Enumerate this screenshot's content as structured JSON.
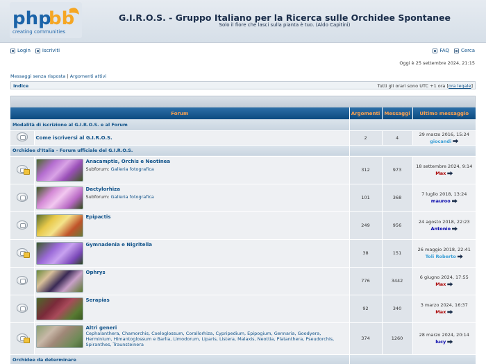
{
  "header": {
    "logo_text": "phpBB",
    "logo_tagline": "creating communities",
    "site_title": "G.I.R.O.S. - Gruppo Italiano per la Ricerca sulle Orchidee Spontanee",
    "site_description": "Solo il fiore che lasci sulla pianta è tuo. (Aldo Capitini)"
  },
  "nav": {
    "login": "Login",
    "register": "Iscriviti",
    "faq": "FAQ",
    "search": "Cerca"
  },
  "date_line": "Oggi è 25 settembre 2024, 21:15",
  "quick_links": {
    "unanswered": "Messaggi senza risposta",
    "separator": "|",
    "active": "Argomenti attivi"
  },
  "breadcrumb": {
    "index": "Indice",
    "timezone_text": "Tutti gli orari sono UTC +1 ora [",
    "legal_time": "ora legale",
    "timezone_close": "]"
  },
  "table_headers": {
    "forum": "Forum",
    "topics": "Argomenti",
    "posts": "Messaggi",
    "last_post": "Ultimo messaggio"
  },
  "categories": [
    {
      "name": "Modalità di iscrizione al G.I.R.O.S. e al Forum",
      "forums": [
        {
          "name": "Come iscriversi al G.I.R.O.S.",
          "subforum": "",
          "topics": "2",
          "posts": "4",
          "last_date": "29 marzo 2016, 15:24",
          "last_user": "giocandi",
          "user_color": "#3a9fd6",
          "new": false,
          "thumb": ""
        }
      ]
    },
    {
      "name": "Orchidee d'Italia - Forum ufficiale del G.I.R.O.S.",
      "forums": [
        {
          "name": "Anacamptis, Orchis e Neotinea",
          "subforum": "Galleria fotografica",
          "topics": "312",
          "posts": "973",
          "last_date": "18 settembre 2024, 9:14",
          "last_user": "Max",
          "user_color": "#aa0000",
          "new": true,
          "thumb": "purple"
        },
        {
          "name": "Dactylorhiza",
          "subforum": "Galleria fotografica",
          "topics": "101",
          "posts": "368",
          "last_date": "7 luglio 2018, 13:24",
          "last_user": "mauroo",
          "user_color": "#0000aa",
          "new": false,
          "thumb": "pink"
        },
        {
          "name": "Epipactis",
          "subforum": "",
          "topics": "249",
          "posts": "956",
          "last_date": "24 agosto 2018, 22:23",
          "last_user": "Antonio",
          "user_color": "#0000aa",
          "new": false,
          "thumb": "yellow"
        },
        {
          "name": "Gymnadenia e Nigritella",
          "subforum": "",
          "topics": "38",
          "posts": "151",
          "last_date": "26 maggio 2018, 22:41",
          "last_user": "Toli Roberto",
          "user_color": "#3a9fd6",
          "new": true,
          "thumb": "violet"
        },
        {
          "name": "Ophrys",
          "subforum": "",
          "topics": "776",
          "posts": "3442",
          "last_date": "6 giugno 2024, 17:55",
          "last_user": "Max",
          "user_color": "#aa0000",
          "new": false,
          "thumb": "ophrys"
        },
        {
          "name": "Serapias",
          "subforum": "",
          "topics": "92",
          "posts": "340",
          "last_date": "3 marzo 2024, 16:37",
          "last_user": "Max",
          "user_color": "#aa0000",
          "new": false,
          "thumb": "serapias"
        },
        {
          "name": "Altri generi",
          "subforum": "",
          "topics": "374",
          "posts": "1260",
          "genera": "Cephalanthera, Chamorchis, Coeloglossum, Corallorhiza, Cypripedium, Epipogium, Gennaria, Goodyera, Herminium, Himantoglossum e Barlia, Limodorum, Liparis, Listera, Malaxis, Neottia, Platanthera, Pseudorchis, Spiranthes, Traunsteinera",
          "last_date": "28 marzo 2024, 20:14",
          "last_user": "lucy",
          "user_color": "#0000aa",
          "new": true,
          "thumb": "himanto"
        }
      ]
    },
    {
      "name": "Orchidee da determinare",
      "forums": []
    }
  ],
  "subforum_label": "Subforum:",
  "colors": {
    "header_blue": "#0b4a80",
    "header_text": "#ffa34f",
    "link": "#105289"
  }
}
